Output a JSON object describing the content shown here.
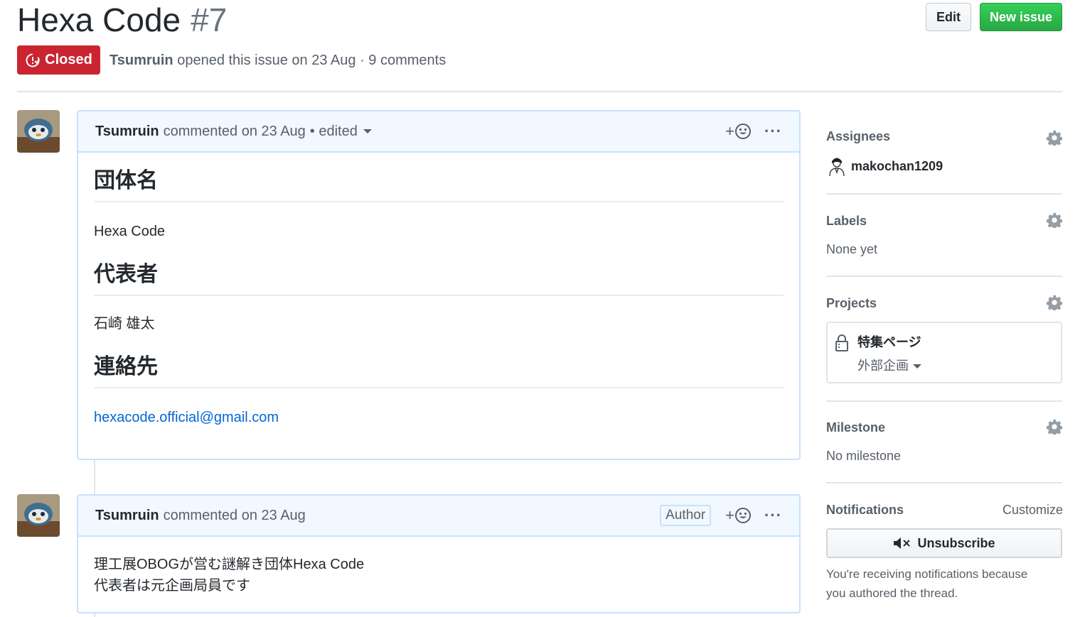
{
  "header": {
    "title": "Hexa Code",
    "number": "#7",
    "edit_label": "Edit",
    "new_issue_label": "New issue",
    "state_label": "Closed",
    "author": "Tsumruin",
    "opened_text": "opened this issue on 23 Aug · 9 comments"
  },
  "comments": [
    {
      "author": "Tsumruin",
      "action": "commented on 23 Aug",
      "edited": "• edited",
      "body": {
        "h1": "団体名",
        "p1": "Hexa Code",
        "h2": "代表者",
        "p2": "石崎 雄太",
        "h3": "連絡先",
        "email": "hexacode.official@gmail.com"
      }
    },
    {
      "author": "Tsumruin",
      "action": "commented on 23 Aug",
      "badge": "Author",
      "line1": "理工展OBOGが営む謎解き団体Hexa Code",
      "line2": "代表者は元企画局員です"
    }
  ],
  "reaction_plus": "+",
  "more_dots": "···",
  "sidebar": {
    "assignees_label": "Assignees",
    "assignee_name": "makochan1209",
    "labels_label": "Labels",
    "labels_value": "None yet",
    "projects_label": "Projects",
    "project_name": "特集ページ",
    "project_column": "外部企画",
    "milestone_label": "Milestone",
    "milestone_value": "No milestone",
    "notifications_label": "Notifications",
    "customize_label": "Customize",
    "unsubscribe_label": "Unsubscribe",
    "notif_line1": "You're receiving notifications because",
    "notif_line2": "you authored the thread."
  },
  "colors": {
    "closed": "#cb2431",
    "new_issue": "#28a745",
    "link": "#0366d6",
    "comment_border": "#c8e1ff",
    "comment_header": "#f1f8ff"
  }
}
